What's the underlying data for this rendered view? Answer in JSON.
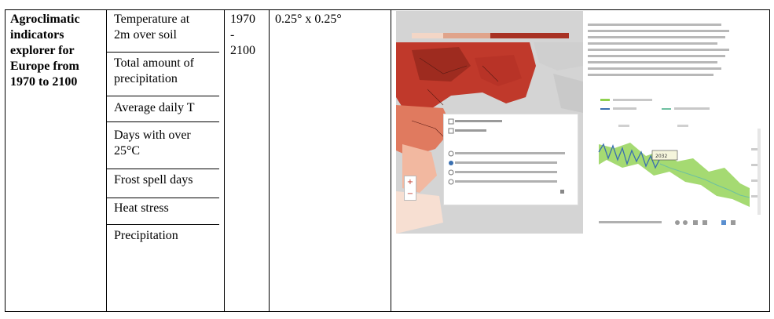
{
  "row": {
    "title": "Agroclimatic indicators explorer for Europe from 1970 to 2100",
    "title_lines": [
      "Agroclimatic",
      "indicators",
      "explorer for",
      "Europe from",
      "1970 to 2100"
    ],
    "variables": [
      {
        "lines": [
          "Temperature at",
          "2m over soil"
        ]
      },
      {
        "lines": [
          "Total amount of",
          "precipitation"
        ]
      },
      {
        "lines": [
          "Average daily T"
        ]
      },
      {
        "lines": [
          "Days with over",
          "25°C"
        ]
      },
      {
        "lines": [
          "Frost spell days"
        ]
      },
      {
        "lines": [
          "Heat stress"
        ]
      },
      {
        "lines": [
          "Precipitation"
        ]
      }
    ],
    "period_lines": [
      "1970",
      "-",
      "2100"
    ],
    "resolution": "0.25° x 0.25°"
  },
  "screenshot": {
    "colors": {
      "map_red": "#c0392b",
      "chart_blue": "#3a6fb0",
      "chart_green": "#8fd14f"
    },
    "chart_marker": "2032"
  }
}
